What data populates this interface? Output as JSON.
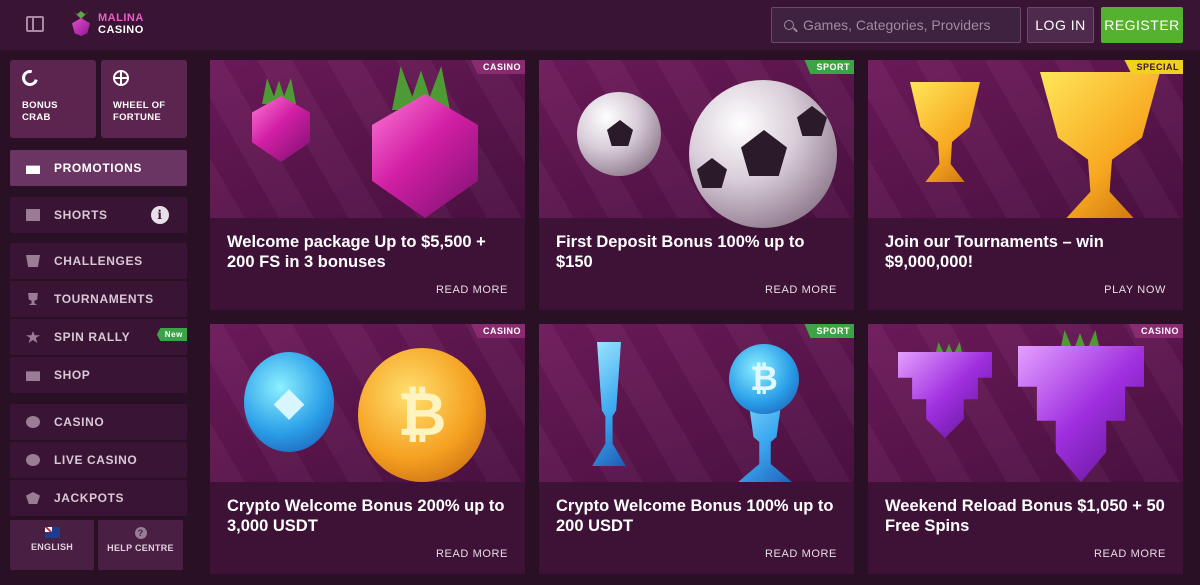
{
  "header": {
    "logo_line1": "MALINA",
    "logo_line2": "CASINO",
    "search_placeholder": "Games, Categories, Providers",
    "login_label": "LOG IN",
    "register_label": "REGISTER"
  },
  "sidebar": {
    "tiles": [
      {
        "label": "BONUS CRAB",
        "icon": "crab-icon"
      },
      {
        "label": "WHEEL OF FORTUNE",
        "icon": "wheel-icon"
      }
    ],
    "items": [
      {
        "label": "PROMOTIONS",
        "icon": "gift-icon",
        "active": true
      },
      {
        "label": "SHORTS",
        "icon": "video-icon"
      },
      {
        "label": "CHALLENGES",
        "icon": "challenge-icon"
      },
      {
        "label": "TOURNAMENTS",
        "icon": "trophy-icon"
      },
      {
        "label": "SPIN RALLY",
        "icon": "spin-rally-icon",
        "badge": "New"
      },
      {
        "label": "SHOP",
        "icon": "shop-icon"
      },
      {
        "label": "CASINO",
        "icon": "cherry-icon"
      },
      {
        "label": "LIVE CASINO",
        "icon": "chip-icon"
      },
      {
        "label": "JACKPOTS",
        "icon": "jackpot-icon"
      }
    ],
    "footer": {
      "language_label": "ENGLISH",
      "help_label": "HELP CENTRE",
      "help_glyph": "?"
    },
    "info_glyph": "i"
  },
  "promotions": [
    {
      "tag": "CASINO",
      "title": "Welcome package Up to $5,500 + 200 FS in 3 bonuses",
      "action": "READ MORE"
    },
    {
      "tag": "SPORT",
      "title": "First Deposit Bonus 100% up to $150",
      "action": "READ MORE"
    },
    {
      "tag": "SPECIAL",
      "title": "Join our Tournaments – win $9,000,000!",
      "action": "PLAY NOW"
    },
    {
      "tag": "CASINO",
      "title": "Crypto Welcome Bonus 200% up to 3,000 USDT",
      "action": "READ MORE"
    },
    {
      "tag": "SPORT",
      "title": "Crypto Welcome Bonus 100% up to 200 USDT",
      "action": "READ MORE"
    },
    {
      "tag": "CASINO",
      "title": "Weekend Reload Bonus $1,050 + 50 Free Spins",
      "action": "READ MORE"
    }
  ],
  "colors": {
    "brand": "#e95fc8",
    "register": "#54b22f",
    "background": "#2a1024",
    "card": "#3d1236"
  }
}
